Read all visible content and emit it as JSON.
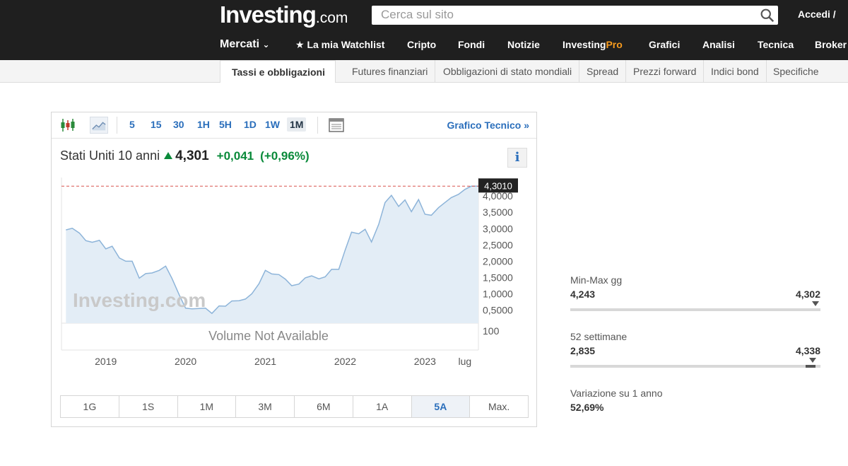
{
  "header": {
    "logo_main": "Investing",
    "logo_suffix": ".com",
    "search_placeholder": "Cerca sul sito",
    "login": "Accedi /",
    "nav": [
      "Mercati",
      "La mia Watchlist",
      "Cripto",
      "Fondi",
      "Notizie",
      "Grafici",
      "Analisi",
      "Tecnica",
      "Broker"
    ],
    "pro_a": "Investing",
    "pro_b": "Pro"
  },
  "subnav": [
    "Tassi e obbligazioni",
    "Futures finanziari",
    "Obbligazioni di stato mondiali",
    "Spread",
    "Prezzi forward",
    "Indici bond",
    "Specifiche"
  ],
  "toolbar": {
    "timeframes": [
      "5",
      "15",
      "30",
      "1H",
      "5H",
      "1D",
      "1W",
      "1M"
    ],
    "active_timeframe": "1M",
    "grafico_tecnico": "Grafico Tecnico »"
  },
  "quote": {
    "name": "Stati Uniti 10 anni",
    "last": "4,301",
    "change": "+0,041",
    "change_pct": "(+0,96%)",
    "info": "i",
    "up_color": "#0a8a3a"
  },
  "chart_data": {
    "type": "area",
    "price_label": "4,3010",
    "watermark": "Investing.com",
    "volume_note": "Volume Not Available",
    "y_ticks": [
      "4,0000",
      "3,5000",
      "3,0000",
      "2,5000",
      "2,0000",
      "1,5000",
      "1,0000",
      "0,5000"
    ],
    "volume_tick": "100",
    "x_ticks": [
      "2019",
      "2020",
      "2021",
      "2022",
      "2023",
      "lug"
    ],
    "ylim": [
      0.1,
      4.35
    ],
    "x": [
      2018.5,
      2018.58,
      2018.67,
      2018.75,
      2018.83,
      2018.92,
      2019.0,
      2019.08,
      2019.17,
      2019.25,
      2019.33,
      2019.42,
      2019.5,
      2019.58,
      2019.67,
      2019.75,
      2019.83,
      2019.92,
      2020.0,
      2020.08,
      2020.17,
      2020.25,
      2020.33,
      2020.42,
      2020.5,
      2020.58,
      2020.67,
      2020.75,
      2020.83,
      2020.92,
      2021.0,
      2021.08,
      2021.17,
      2021.25,
      2021.33,
      2021.42,
      2021.5,
      2021.58,
      2021.67,
      2021.75,
      2021.83,
      2021.92,
      2022.0,
      2022.08,
      2022.17,
      2022.25,
      2022.33,
      2022.42,
      2022.5,
      2022.58,
      2022.67,
      2022.75,
      2022.83,
      2022.92,
      2023.0,
      2023.08,
      2023.17,
      2023.25,
      2023.33,
      2023.42,
      2023.5,
      2023.58,
      2023.67
    ],
    "values": [
      2.96,
      3.01,
      2.86,
      2.63,
      2.58,
      2.64,
      2.38,
      2.46,
      2.1,
      2.0,
      2.0,
      1.48,
      1.62,
      1.64,
      1.72,
      1.85,
      1.47,
      0.97,
      0.56,
      0.54,
      0.55,
      0.56,
      0.4,
      0.63,
      0.62,
      0.78,
      0.79,
      0.84,
      1.0,
      1.31,
      1.72,
      1.61,
      1.59,
      1.45,
      1.25,
      1.3,
      1.49,
      1.55,
      1.46,
      1.52,
      1.75,
      1.75,
      2.34,
      2.89,
      2.84,
      2.98,
      2.59,
      3.13,
      3.8,
      4.02,
      3.68,
      3.88,
      3.52,
      3.89,
      3.44,
      3.41,
      3.64,
      3.8,
      3.95,
      4.05,
      4.2,
      4.3,
      4.3
    ]
  },
  "ranges": [
    "1G",
    "1S",
    "1M",
    "3M",
    "6M",
    "1A",
    "5A",
    "Max."
  ],
  "active_range": "5A",
  "stats": {
    "day": {
      "label": "Min-Max gg",
      "min": "4,243",
      "max": "4,302",
      "position": 0.98
    },
    "week52": {
      "label": "52 settimane",
      "min": "2,835",
      "max": "4,338",
      "position": 0.97
    },
    "year_change": {
      "label": "Variazione su 1 anno",
      "value": "52,69%"
    }
  }
}
